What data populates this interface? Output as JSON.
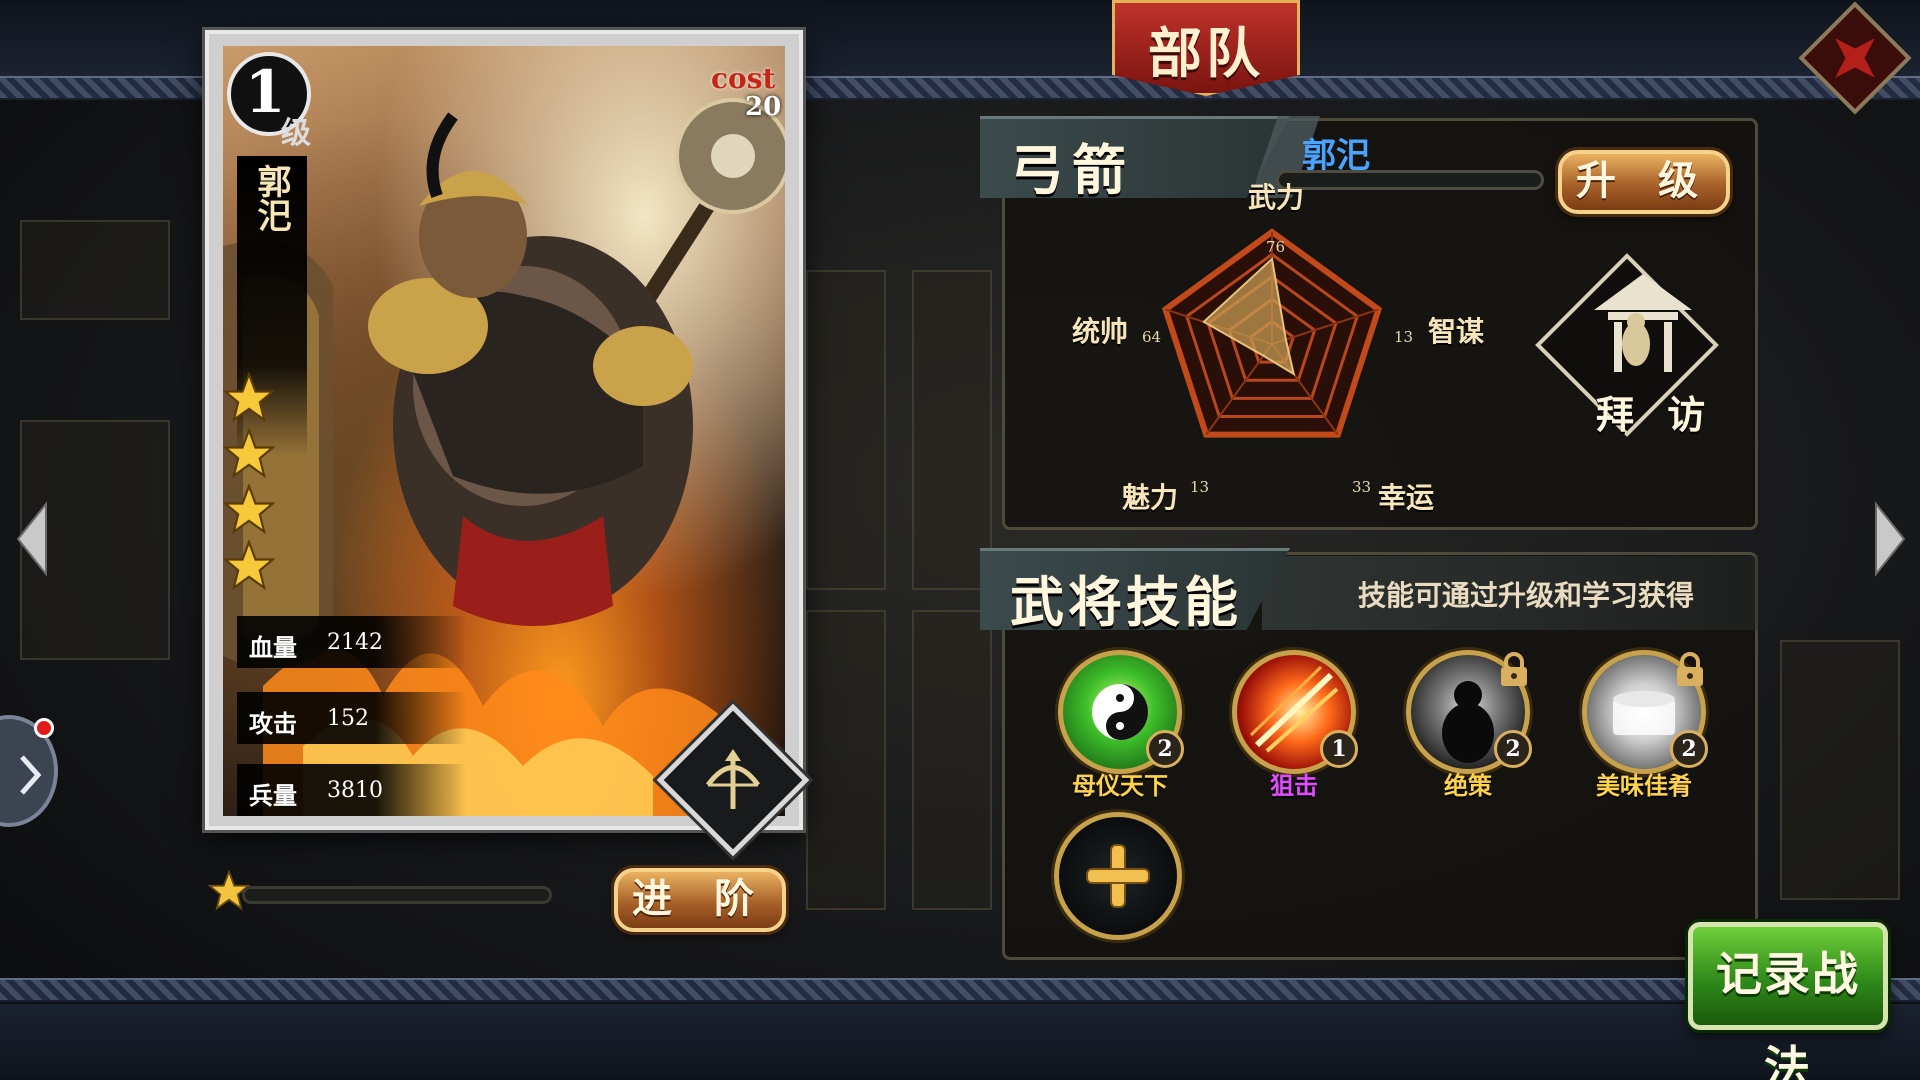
{
  "title": "部队",
  "hero": {
    "level": "1",
    "level_unit": "级",
    "cost_label": "cost",
    "cost": "20",
    "name": "郭汜",
    "stars": 4,
    "stats": {
      "hp_label": "血量",
      "hp": "2142",
      "atk_label": "攻击",
      "atk": "152",
      "troops_label": "兵量",
      "troops": "3810"
    },
    "star_progress": 0.0
  },
  "buttons": {
    "advance": "进 阶",
    "upgrade": "升 级",
    "visit": "拜 访",
    "record": "记录战法"
  },
  "class_panel": {
    "class_name": "弓箭",
    "hero_name": "郭汜",
    "exp_progress": 0.0
  },
  "radar": {
    "axes": [
      {
        "label": "武力",
        "value": 76
      },
      {
        "label": "智谋",
        "value": 13
      },
      {
        "label": "幸运",
        "value": 33
      },
      {
        "label": "魅力",
        "value": 13
      },
      {
        "label": "统帅",
        "value": 64
      }
    ],
    "max": 100
  },
  "skills": {
    "title": "武将技能",
    "hint": "技能可通过升级和学习获得",
    "items": [
      {
        "name": "母仪天下",
        "level": "2",
        "locked": false,
        "color": "#ffd34a",
        "icon": "yin-yang-icon"
      },
      {
        "name": "狙击",
        "level": "1",
        "locked": false,
        "color": "#e24cff",
        "icon": "strike-icon"
      },
      {
        "name": "绝策",
        "level": "2",
        "locked": true,
        "color": "#ffd34a",
        "icon": "shadow-figure-icon"
      },
      {
        "name": "美味佳肴",
        "level": "2",
        "locked": true,
        "color": "#ffd34a",
        "icon": "feast-icon"
      }
    ]
  },
  "colors": {
    "hero_name_blue": "#4aa4ff",
    "title_red": "#b3261e",
    "record_green": "#2f8a1a"
  }
}
